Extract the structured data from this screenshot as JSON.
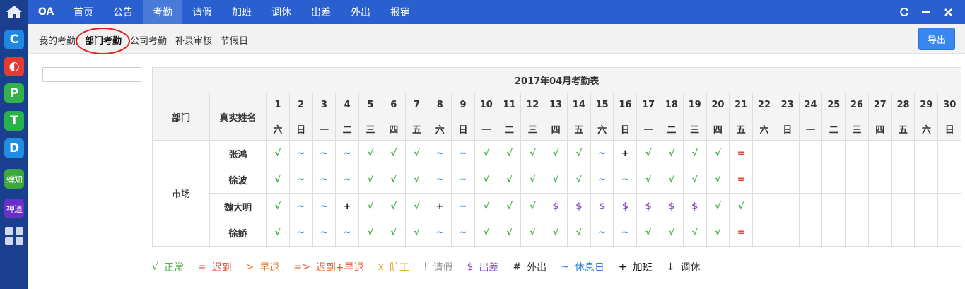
{
  "dock": {
    "apps": [
      {
        "letter": "C",
        "color": "#1e88e5"
      },
      {
        "letter": "◐",
        "color": "#e53935"
      },
      {
        "letter": "P",
        "color": "#2fb34a"
      },
      {
        "letter": "T",
        "color": "#27b24a"
      },
      {
        "letter": "D",
        "color": "#1f8de0"
      },
      {
        "letter": "蝉知",
        "color": "#3aa83a"
      },
      {
        "letter": "禅道",
        "color": "#6a2fc6"
      }
    ]
  },
  "topnav": {
    "brand": "OA",
    "items": [
      "首页",
      "公告",
      "考勤",
      "请假",
      "加班",
      "调休",
      "出差",
      "外出",
      "报销"
    ],
    "active": "考勤",
    "controls": {
      "refresh": "⟳",
      "minimize": "—",
      "close": "✕"
    }
  },
  "subnav": {
    "items": [
      "我的考勤",
      "部门考勤",
      "公司考勤",
      "补录审核",
      "节假日"
    ],
    "active": "部门考勤",
    "export": "导出"
  },
  "search": {
    "value": "",
    "placeholder": ""
  },
  "table": {
    "title": "2017年04月考勤表",
    "col_dept": "部门",
    "col_name": "真实姓名",
    "days": [
      "1",
      "2",
      "3",
      "4",
      "5",
      "6",
      "7",
      "8",
      "9",
      "10",
      "11",
      "12",
      "13",
      "14",
      "15",
      "16",
      "17",
      "18",
      "19",
      "20",
      "21",
      "22",
      "23",
      "24",
      "25",
      "26",
      "27",
      "28",
      "29",
      "30"
    ],
    "weekdays": [
      "六",
      "日",
      "一",
      "二",
      "三",
      "四",
      "五",
      "六",
      "日",
      "一",
      "二",
      "三",
      "四",
      "五",
      "六",
      "日",
      "一",
      "二",
      "三",
      "四",
      "五",
      "六",
      "日",
      "一",
      "二",
      "三",
      "四",
      "五",
      "六",
      "日"
    ],
    "dept": "市场",
    "rows": [
      {
        "name": "张鸿",
        "marks": [
          "√",
          "~",
          "~",
          "~",
          "√",
          "√",
          "√",
          "~",
          "~",
          "√",
          "√",
          "√",
          "√",
          "√",
          "~",
          "+",
          "√",
          "√",
          "√",
          "√",
          "=",
          "",
          "",
          "",
          "",
          "",
          "",
          "",
          "",
          ""
        ]
      },
      {
        "name": "徐波",
        "marks": [
          "√",
          "~",
          "~",
          "~",
          "√",
          "√",
          "√",
          "~",
          "~",
          "√",
          "√",
          "√",
          "√",
          "√",
          "~",
          "~",
          "√",
          "√",
          "√",
          "√",
          "=",
          "",
          "",
          "",
          "",
          "",
          "",
          "",
          "",
          ""
        ]
      },
      {
        "name": "魏大明",
        "marks": [
          "√",
          "~",
          "~",
          "+",
          "√",
          "√",
          "√",
          "+",
          "~",
          "√",
          "√",
          "√",
          "$",
          "$",
          "$",
          "$",
          "$",
          "$",
          "$",
          "√",
          "√",
          "",
          "",
          "",
          "",
          "",
          "",
          "",
          "",
          ""
        ]
      },
      {
        "name": "徐娇",
        "marks": [
          "√",
          "~",
          "~",
          "~",
          "√",
          "√",
          "√",
          "~",
          "~",
          "√",
          "√",
          "√",
          "√",
          "√",
          "~",
          "~",
          "√",
          "√",
          "√",
          "√",
          "=",
          "",
          "",
          "",
          "",
          "",
          "",
          "",
          "",
          ""
        ]
      }
    ]
  },
  "legend": [
    {
      "sym": "√",
      "label": "正常",
      "color": "#4ab34a"
    },
    {
      "sym": "=",
      "label": "迟到",
      "color": "#e14b3b"
    },
    {
      "sym": ">",
      "label": "早退",
      "color": "#ee7a28"
    },
    {
      "sym": "=>",
      "label": "迟到+早退",
      "color": "#e25a2a"
    },
    {
      "sym": "x",
      "label": "旷工",
      "color": "#f0a020"
    },
    {
      "sym": "!",
      "label": "请假",
      "color": "#999999"
    },
    {
      "sym": "$",
      "label": "出差",
      "color": "#8e59c2"
    },
    {
      "sym": "#",
      "label": "外出",
      "color": "#333333"
    },
    {
      "sym": "~",
      "label": "休息日",
      "color": "#2f7de1"
    },
    {
      "sym": "+",
      "label": "加班",
      "color": "#111111"
    },
    {
      "sym": "↓",
      "label": "调休",
      "color": "#333333"
    }
  ]
}
